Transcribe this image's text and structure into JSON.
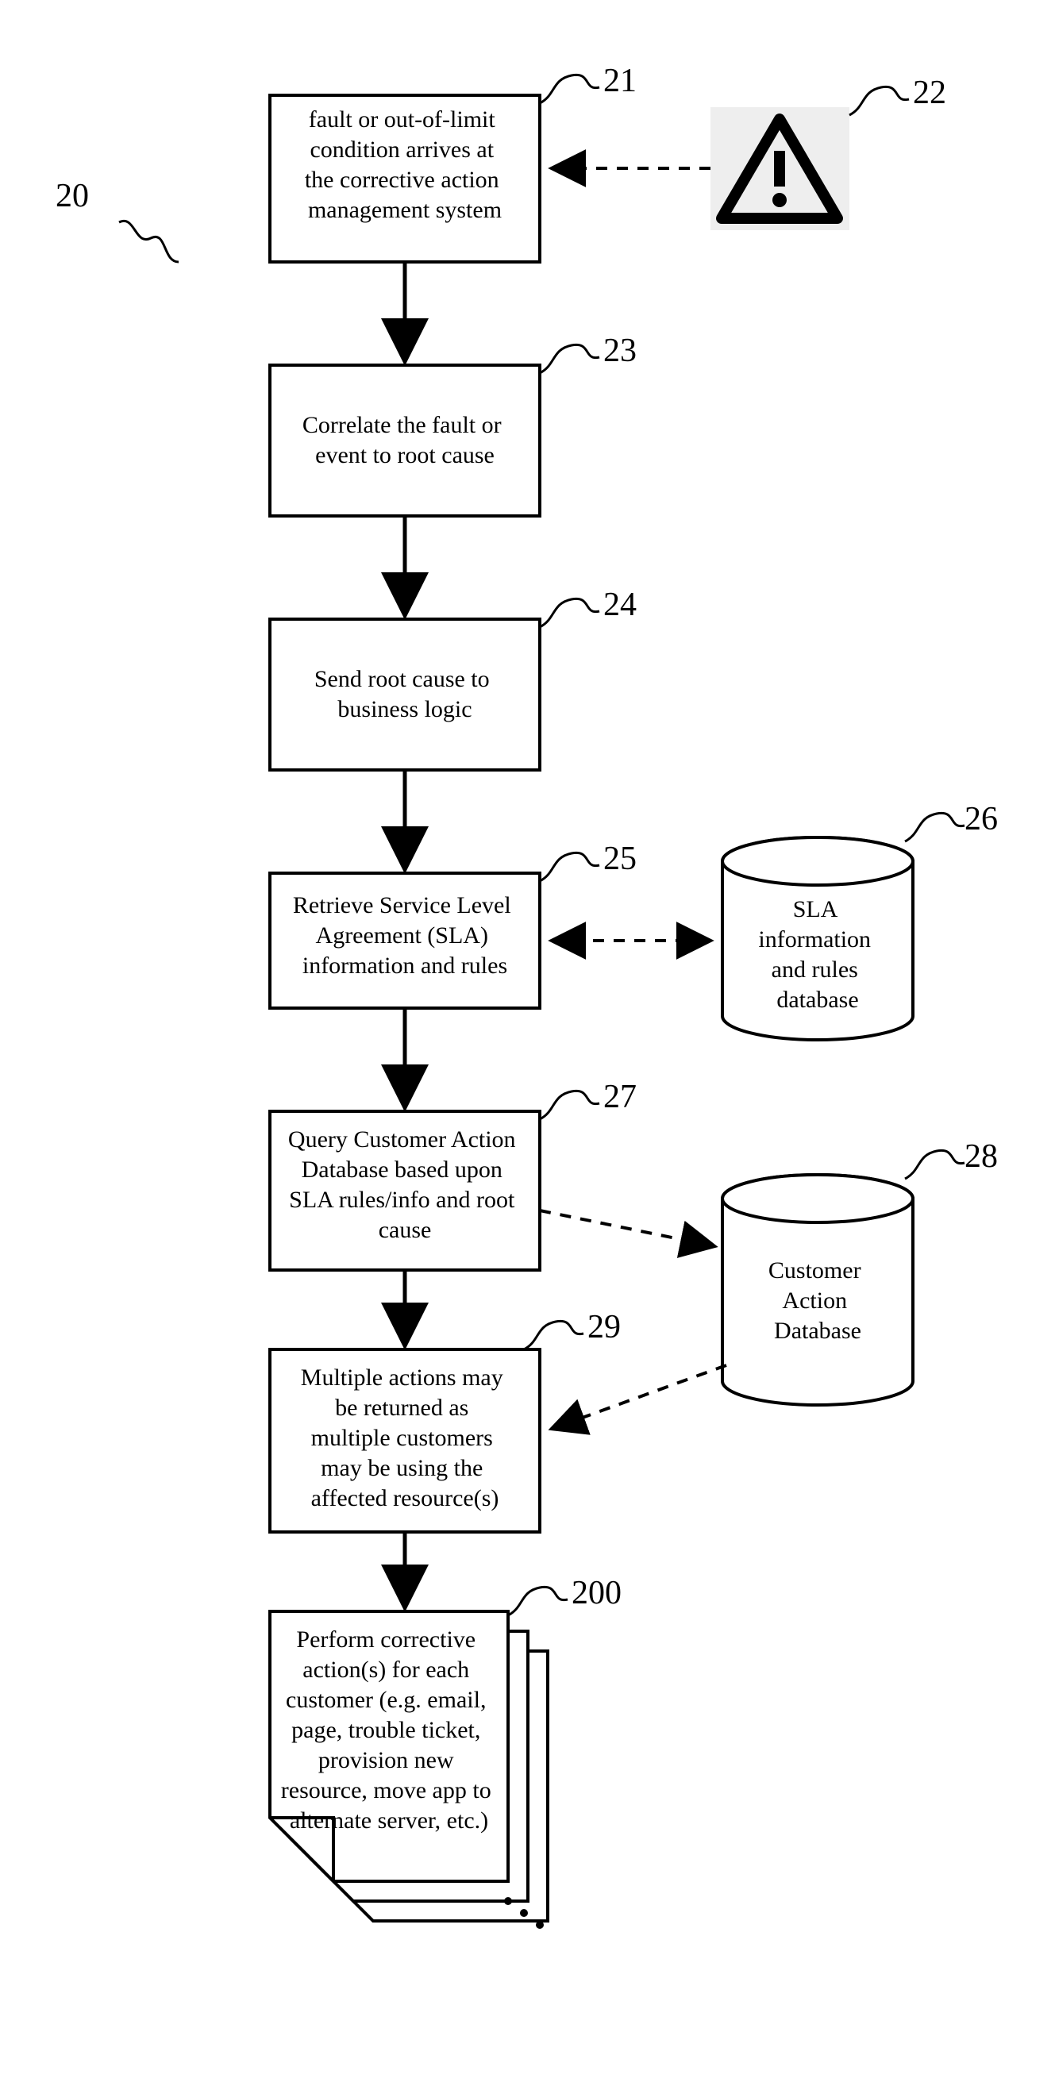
{
  "diagram": {
    "title_label": "20",
    "nodes": {
      "n21": {
        "ref": "21",
        "text": "fault or out-of-limit condition arrives at the corrective action management system"
      },
      "n22": {
        "ref": "22",
        "icon": "warning"
      },
      "n23": {
        "ref": "23",
        "text": "Correlate the fault or event to root cause"
      },
      "n24": {
        "ref": "24",
        "text": "Send root cause to business logic"
      },
      "n25": {
        "ref": "25",
        "text": "Retrieve Service Level Agreement (SLA) information and rules"
      },
      "n26": {
        "ref": "26",
        "text": "SLA information and rules database"
      },
      "n27": {
        "ref": "27",
        "text": "Query Customer Action Database based upon SLA rules/info and root cause"
      },
      "n28": {
        "ref": "28",
        "text": "Customer Action Database"
      },
      "n29": {
        "ref": "29",
        "text": "Multiple actions may be returned as multiple customers may be using the affected resource(s)"
      },
      "n200": {
        "ref": "200",
        "text": "Perform corrective action(s) for each customer (e.g. email, page, trouble ticket, provision new resource, move app to alternate server, etc.)"
      }
    },
    "edges": [
      {
        "from": "n21",
        "to": "n23",
        "style": "solid"
      },
      {
        "from": "n23",
        "to": "n24",
        "style": "solid"
      },
      {
        "from": "n24",
        "to": "n25",
        "style": "solid"
      },
      {
        "from": "n25",
        "to": "n27",
        "style": "solid"
      },
      {
        "from": "n27",
        "to": "n29",
        "style": "solid"
      },
      {
        "from": "n29",
        "to": "n200",
        "style": "solid"
      },
      {
        "from": "n22",
        "to": "n21",
        "style": "dashed"
      },
      {
        "from": "n25",
        "to": "n26",
        "style": "dashed-bidir"
      },
      {
        "from": "n27",
        "to": "n28",
        "style": "dashed"
      },
      {
        "from": "n28",
        "to": "n29",
        "style": "dashed"
      }
    ]
  }
}
